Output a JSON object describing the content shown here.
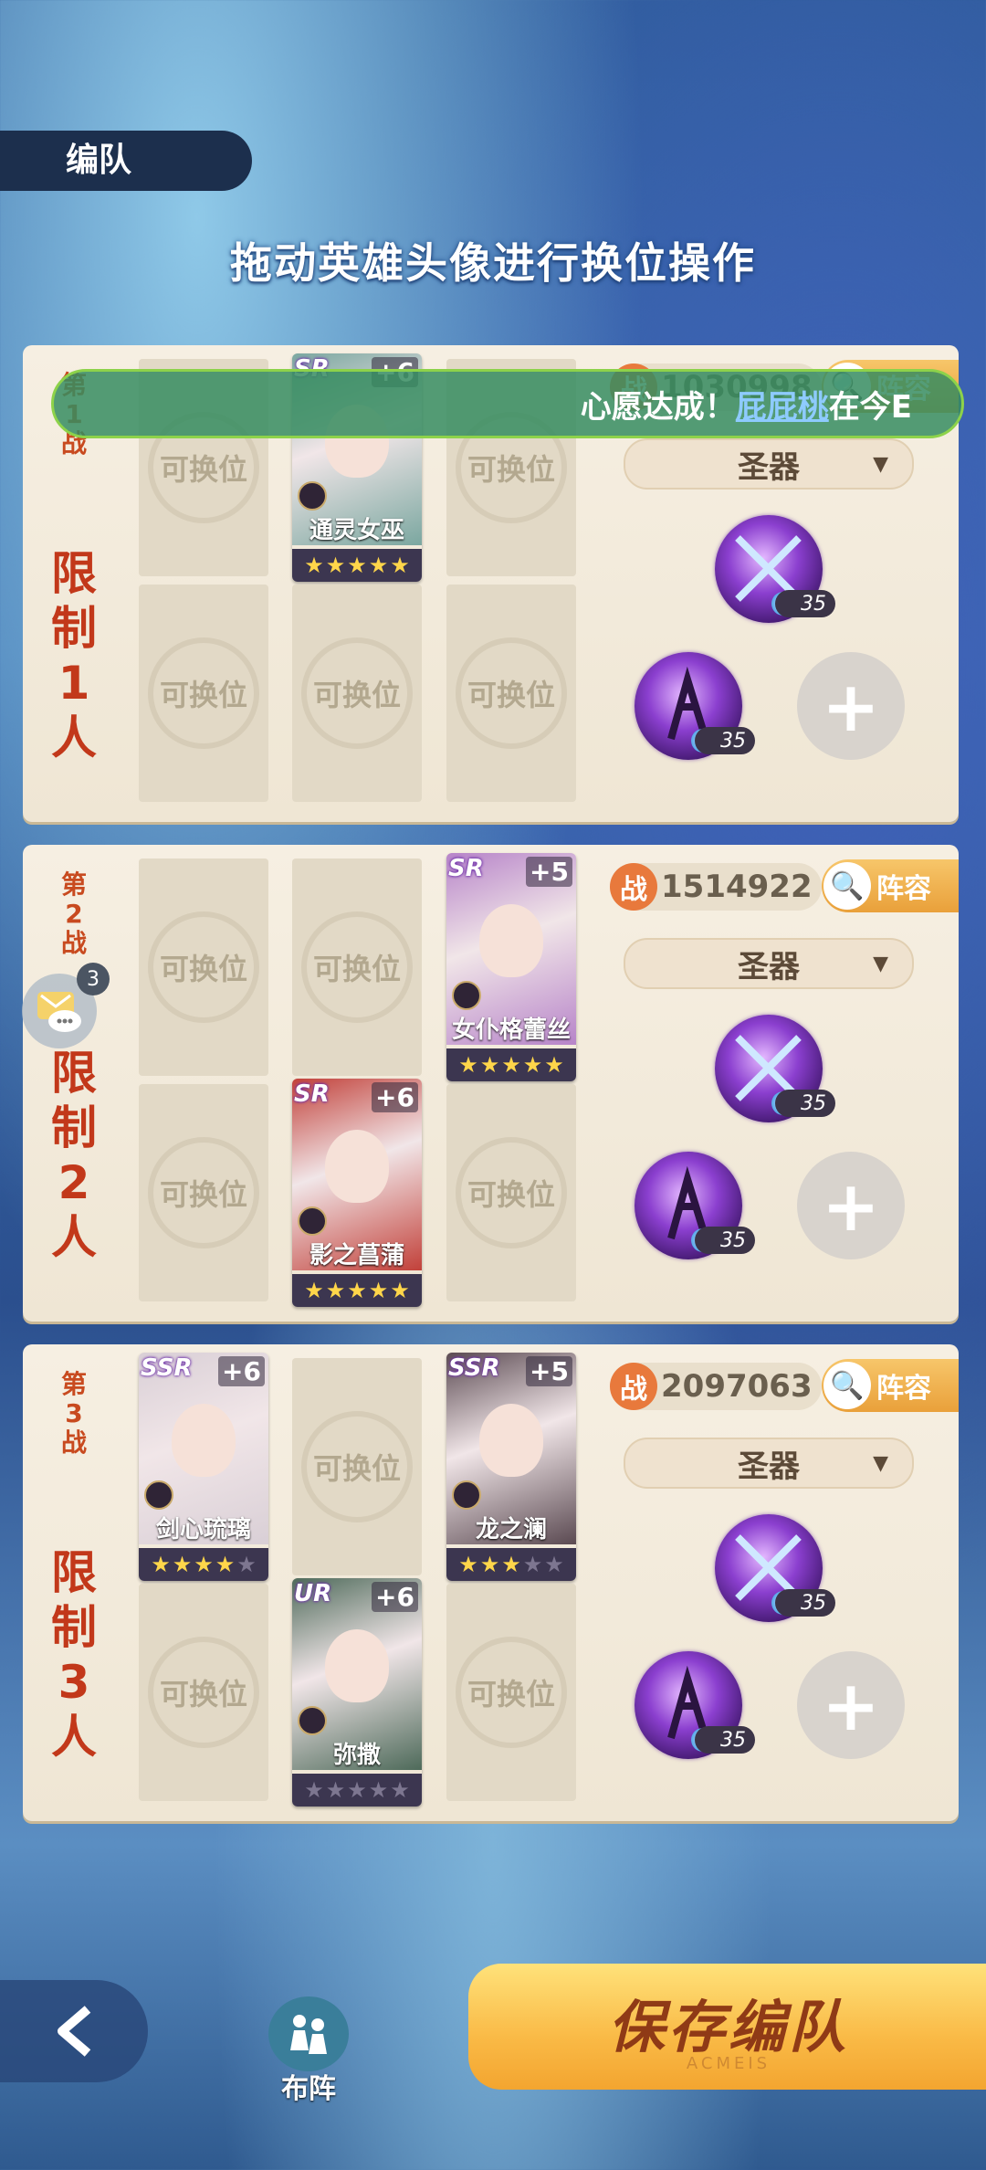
{
  "header": {
    "tab_label": "编队",
    "instruction": "拖动英雄头像进行换位操作"
  },
  "toast": {
    "prefix": "心愿达成！",
    "link": "屁屁桃",
    "suffix": "在今E"
  },
  "empty_slot_label": "可换位",
  "battles": [
    {
      "label": "第1战",
      "limit": "限制1人",
      "power_badge": "战",
      "power": "1030998",
      "lineup_label": "阵容",
      "artifact_label": "圣器",
      "artifact_levels": [
        "35",
        "35"
      ],
      "hero_slots": [
        {
          "empty": true
        },
        {
          "empty": false,
          "rank": "SR",
          "plus": "+6",
          "name": "通灵女巫",
          "stars": 5,
          "max_stars": 5,
          "color": "#7ba7a0"
        },
        {
          "empty": true
        },
        {
          "empty": true
        },
        {
          "empty": true
        },
        {
          "empty": true
        }
      ]
    },
    {
      "label": "第2战",
      "limit": "限制2人",
      "power_badge": "战",
      "power": "1514922",
      "lineup_label": "阵容",
      "artifact_label": "圣器",
      "artifact_levels": [
        "35",
        "35"
      ],
      "hero_slots": [
        {
          "empty": true
        },
        {
          "empty": true
        },
        {
          "empty": false,
          "rank": "SR",
          "plus": "+5",
          "name": "女仆格蕾丝",
          "stars": 5,
          "max_stars": 5,
          "color": "#b784c9"
        },
        {
          "empty": true
        },
        {
          "empty": false,
          "rank": "SR",
          "plus": "+6",
          "name": "影之菖蒲",
          "stars": 5,
          "max_stars": 5,
          "color": "#c2413a"
        },
        {
          "empty": true
        }
      ]
    },
    {
      "label": "第3战",
      "limit": "限制3人",
      "power_badge": "战",
      "power": "2097063",
      "lineup_label": "阵容",
      "artifact_label": "圣器",
      "artifact_levels": [
        "35",
        "35"
      ],
      "hero_slots": [
        {
          "empty": false,
          "rank": "SSR",
          "plus": "+6",
          "name": "剑心琉璃",
          "stars": 4,
          "max_stars": 5,
          "color": "#d9cfd6"
        },
        {
          "empty": true
        },
        {
          "empty": false,
          "rank": "SSR",
          "plus": "+5",
          "name": "龙之澜",
          "stars": 3,
          "max_stars": 5,
          "color": "#5b4a52"
        },
        {
          "empty": true
        },
        {
          "empty": false,
          "rank": "UR",
          "plus": "+6",
          "name": "弥撒",
          "stars": 0,
          "max_stars": 5,
          "color": "#4e6a5a"
        },
        {
          "empty": true
        }
      ]
    }
  ],
  "chat": {
    "unread": "3"
  },
  "footer": {
    "formation_label": "布阵",
    "save_label": "保存编队",
    "save_watermark": "ACMEIS"
  }
}
